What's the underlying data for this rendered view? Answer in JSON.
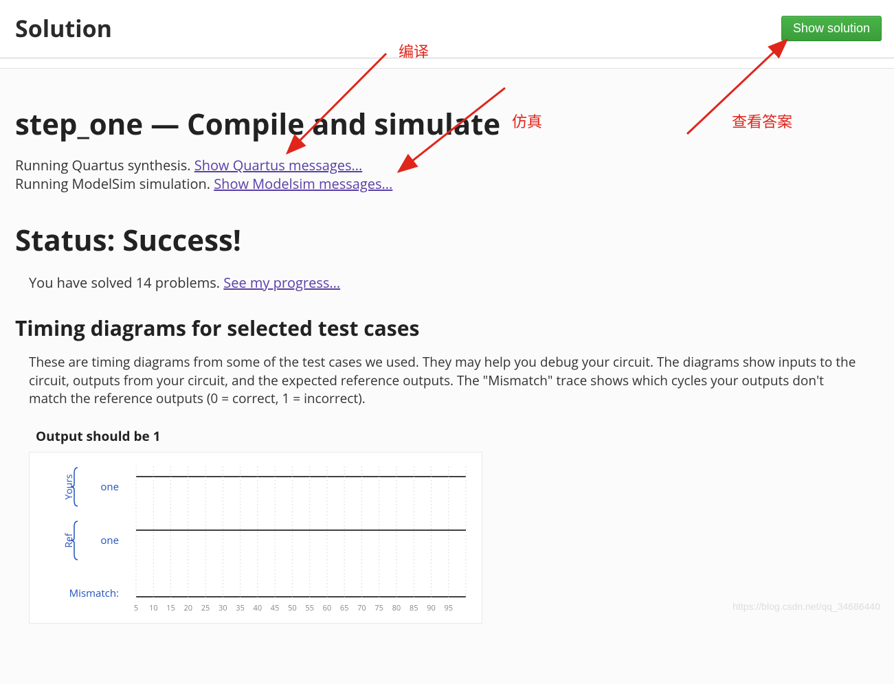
{
  "header": {
    "title": "Solution",
    "show_solution_label": "Show solution"
  },
  "page": {
    "title": "step_one — Compile and simulate",
    "quartus_running": "Running Quartus synthesis. ",
    "quartus_link": "Show Quartus messages...",
    "modelsim_running": "Running ModelSim simulation. ",
    "modelsim_link": "Show Modelsim messages..."
  },
  "status": {
    "heading": "Status: Success!",
    "solved_prefix": "You have solved ",
    "solved_count": "14",
    "solved_suffix": " problems. ",
    "progress_link": "See my progress..."
  },
  "timing": {
    "heading": "Timing diagrams for selected test cases",
    "description": "These are timing diagrams from some of the test cases we used. They may help you debug your circuit. The diagrams show inputs to the circuit, outputs from your circuit, and the expected reference outputs. The \"Mismatch\" trace shows which cycles your outputs don't match the reference outputs (0 = correct, 1 = incorrect).",
    "diagram": {
      "title": "Output should be 1",
      "yours_group": "Yours",
      "ref_group": "Ref",
      "mismatch_label": "Mismatch:",
      "signal1": "one",
      "signal2": "one",
      "x_ticks": [
        "5",
        "10",
        "15",
        "20",
        "25",
        "30",
        "35",
        "40",
        "45",
        "50",
        "55",
        "60",
        "65",
        "70",
        "75",
        "80",
        "85",
        "90",
        "95"
      ]
    }
  },
  "annotations": {
    "compile": "编译",
    "simulate": "仿真",
    "show_answer": "查看答案"
  },
  "watermark": "https://blog.csdn.net/qq_34686440"
}
